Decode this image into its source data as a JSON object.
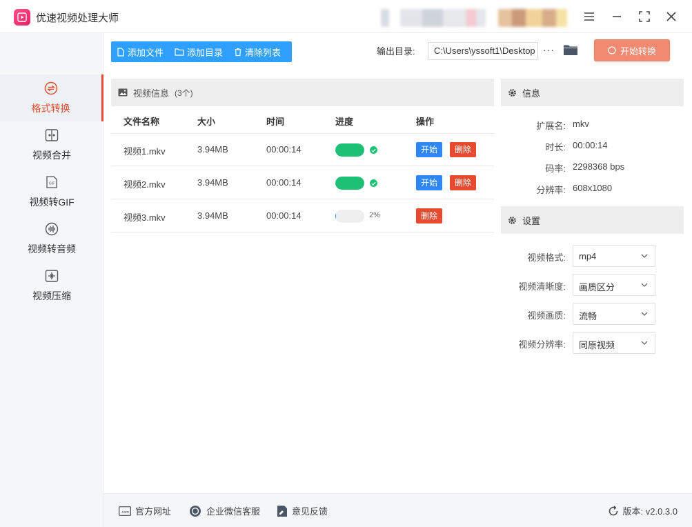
{
  "app": {
    "title": "优速视频处理大师"
  },
  "sidebar": {
    "items": [
      {
        "label": "格式转换",
        "icon": "convert-icon",
        "active": true
      },
      {
        "label": "视频合并",
        "icon": "merge-icon",
        "active": false
      },
      {
        "label": "视频转GIF",
        "icon": "gif-icon",
        "active": false
      },
      {
        "label": "视频转音频",
        "icon": "audio-icon",
        "active": false
      },
      {
        "label": "视频压缩",
        "icon": "compress-icon",
        "active": false
      }
    ]
  },
  "toolbar": {
    "add_file": "添加文件",
    "add_dir": "添加目录",
    "clear_list": "清除列表",
    "output_label": "输出目录:",
    "output_path": "C:\\Users\\yssoft1\\Desktop",
    "more": "···",
    "start": "开始转换"
  },
  "file_panel": {
    "title": "视频信息",
    "count": "(3个)",
    "columns": [
      "文件名称",
      "大小",
      "时间",
      "进度",
      "操作"
    ],
    "rows": [
      {
        "name": "视频1.mkv",
        "size": "3.94MB",
        "time": "00:00:14",
        "progress": 1.0,
        "start": "开始",
        "delete": "删除"
      },
      {
        "name": "视频2.mkv",
        "size": "3.94MB",
        "time": "00:00:14",
        "progress": 1.0,
        "start": "开始",
        "delete": "删除"
      },
      {
        "name": "视频3.mkv",
        "size": "3.94MB",
        "time": "00:00:14",
        "progress": 0.02,
        "progress_text": "2%",
        "delete": "删除"
      }
    ]
  },
  "info": {
    "title": "信息",
    "items": [
      {
        "label": "扩展名:",
        "value": "mkv"
      },
      {
        "label": "时长:",
        "value": "00:00:14"
      },
      {
        "label": "码率:",
        "value": "2298368 bps"
      },
      {
        "label": "分辨率:",
        "value": "608x1080"
      }
    ]
  },
  "settings": {
    "title": "设置",
    "items": [
      {
        "label": "视频格式:",
        "value": "mp4"
      },
      {
        "label": "视频清晰度:",
        "value": "画质区分"
      },
      {
        "label": "视频画质:",
        "value": "流畅"
      },
      {
        "label": "视频分辨率:",
        "value": "同原视频"
      }
    ]
  },
  "footer": {
    "website": "官方网址",
    "wechat": "企业微信客服",
    "feedback": "意见反馈",
    "version": "版本: v2.0.3.0"
  },
  "colors": {
    "accent_red": "#e84a2f",
    "toolbar_blue": "#2fa0ff",
    "start_orange": "#f28a72",
    "progress_green": "#1ec174",
    "action_blue": "#2f86f6"
  }
}
